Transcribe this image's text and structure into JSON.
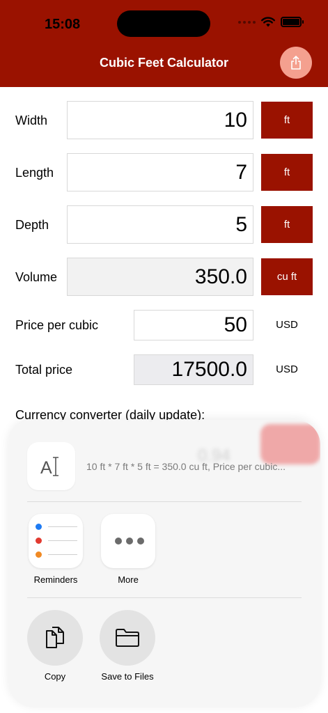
{
  "status_bar": {
    "time": "15:08"
  },
  "app": {
    "title": "Cubic Feet Calculator",
    "accent_color": "#9a1200"
  },
  "fields": [
    {
      "label": "Width",
      "value": "10",
      "unit": "ft"
    },
    {
      "label": "Length",
      "value": "7",
      "unit": "ft"
    },
    {
      "label": "Depth",
      "value": "5",
      "unit": "ft"
    },
    {
      "label": "Volume",
      "value": "350.0",
      "unit": "cu ft"
    }
  ],
  "price": {
    "label": "Price per cubic",
    "value": "50",
    "currency": "USD"
  },
  "total": {
    "label": "Total price",
    "value": "17500.0",
    "currency": "USD"
  },
  "currency_converter": {
    "label": "Currency converter (daily update):",
    "peek_value": "0.94"
  },
  "share_sheet": {
    "preview_text": "10 ft * 7 ft * 5 ft = 350.0 cu ft, Price per cubic...",
    "apps": [
      {
        "label": "Reminders",
        "icon": "reminders-icon"
      },
      {
        "label": "More",
        "icon": "more-icon"
      }
    ],
    "actions": [
      {
        "label": "Copy",
        "icon": "copy-icon"
      },
      {
        "label": "Save to Files",
        "icon": "folder-icon"
      }
    ]
  }
}
